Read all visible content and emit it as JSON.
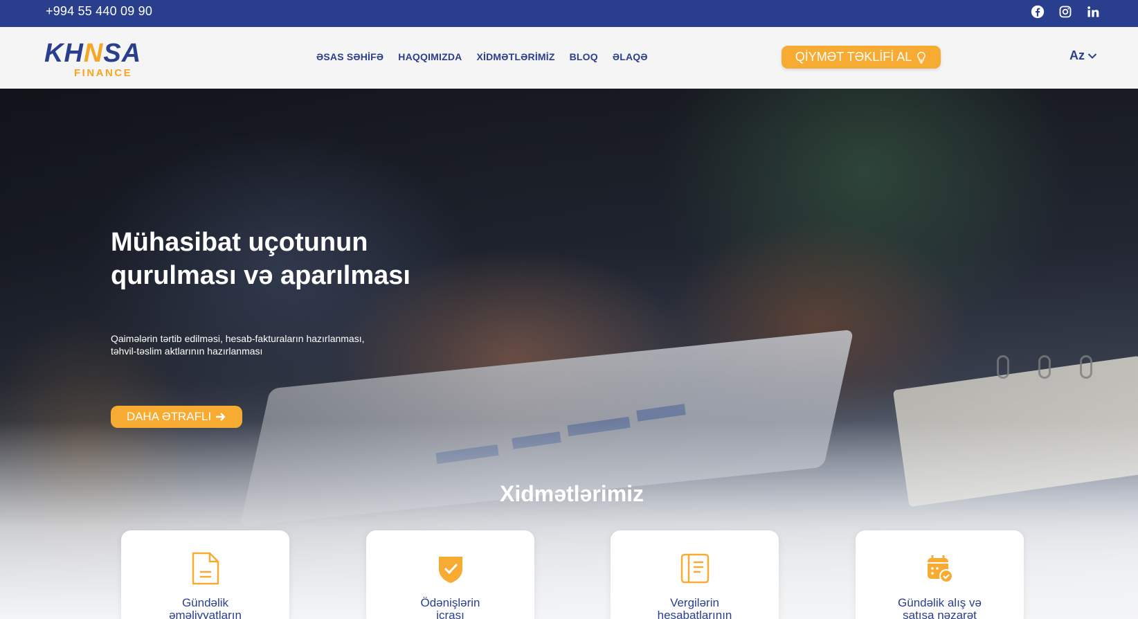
{
  "topbar": {
    "phone": "+994 55 440 09 90",
    "social": [
      {
        "name": "facebook-icon"
      },
      {
        "name": "instagram-icon"
      },
      {
        "name": "linkedin-icon"
      }
    ]
  },
  "header": {
    "logo": {
      "word_start": "KH",
      "word_n": "N",
      "word_end": "SA",
      "sub": "FINANCE"
    },
    "nav": [
      "ƏSAS SƏHİFƏ",
      "HAQQIMIZDA",
      "XİDMƏTLƏRİMİZ",
      "BLOQ",
      "ƏLAQƏ"
    ],
    "quote_button": "QİYMƏT TƏKLİFİ AL",
    "language": "Az"
  },
  "hero": {
    "title_line1": "Mühasibat uçotunun",
    "title_line2": "qurulması və aparılması",
    "desc_line1": "Qaimələrin tərtib edilməsi, hesab-fakturaların hazırlanması,",
    "desc_line2": "təhvil-təslim aktlarının hazırlanması",
    "more_button": "DAHA ƏTRAFLI"
  },
  "services": {
    "title": "Xidmətlərimiz",
    "cards": [
      {
        "icon": "document-icon",
        "line1": "Gündəlik",
        "line2": "əməliyyatların"
      },
      {
        "icon": "shield-check-icon",
        "line1": "Ödənişlərin",
        "line2": "icrası"
      },
      {
        "icon": "ledger-icon",
        "line1": "Vergilərin",
        "line2": "hesabatlarının"
      },
      {
        "icon": "calendar-check-icon",
        "line1": "Gündəlik alış və",
        "line2": "satışa nəzarət"
      }
    ]
  },
  "colors": {
    "brand_blue": "#2a3e8e",
    "accent_orange": "#f7ab32",
    "header_bg": "#f5f5f5"
  }
}
